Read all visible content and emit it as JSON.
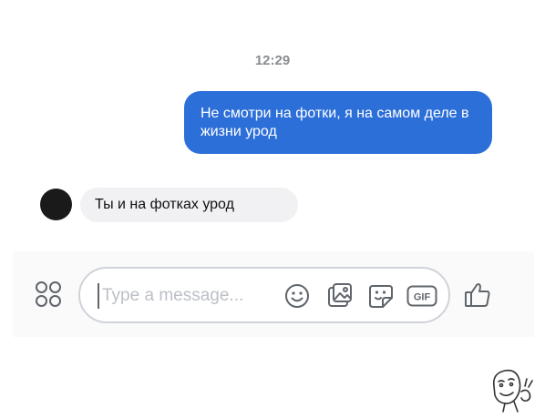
{
  "conversation": {
    "timestamp": "12:29",
    "messages": [
      {
        "direction": "outgoing",
        "text": "Не смотри на фотки, я на самом деле в жизни урод"
      },
      {
        "direction": "incoming",
        "text": "Ты и на фотках урод"
      }
    ]
  },
  "composer": {
    "placeholder": "Type a message...",
    "icons": [
      "apps-grid-icon",
      "emoji-icon",
      "image-icon",
      "sticker-icon",
      "gif-icon",
      "thumbs-up-icon"
    ]
  },
  "colors": {
    "outgoing_bubble": "#2d6fd8",
    "incoming_bubble": "#f1f1f4",
    "avatar": "#1a1a1a",
    "icon_gray": "#60656b",
    "timestamp": "#8a8d91"
  }
}
